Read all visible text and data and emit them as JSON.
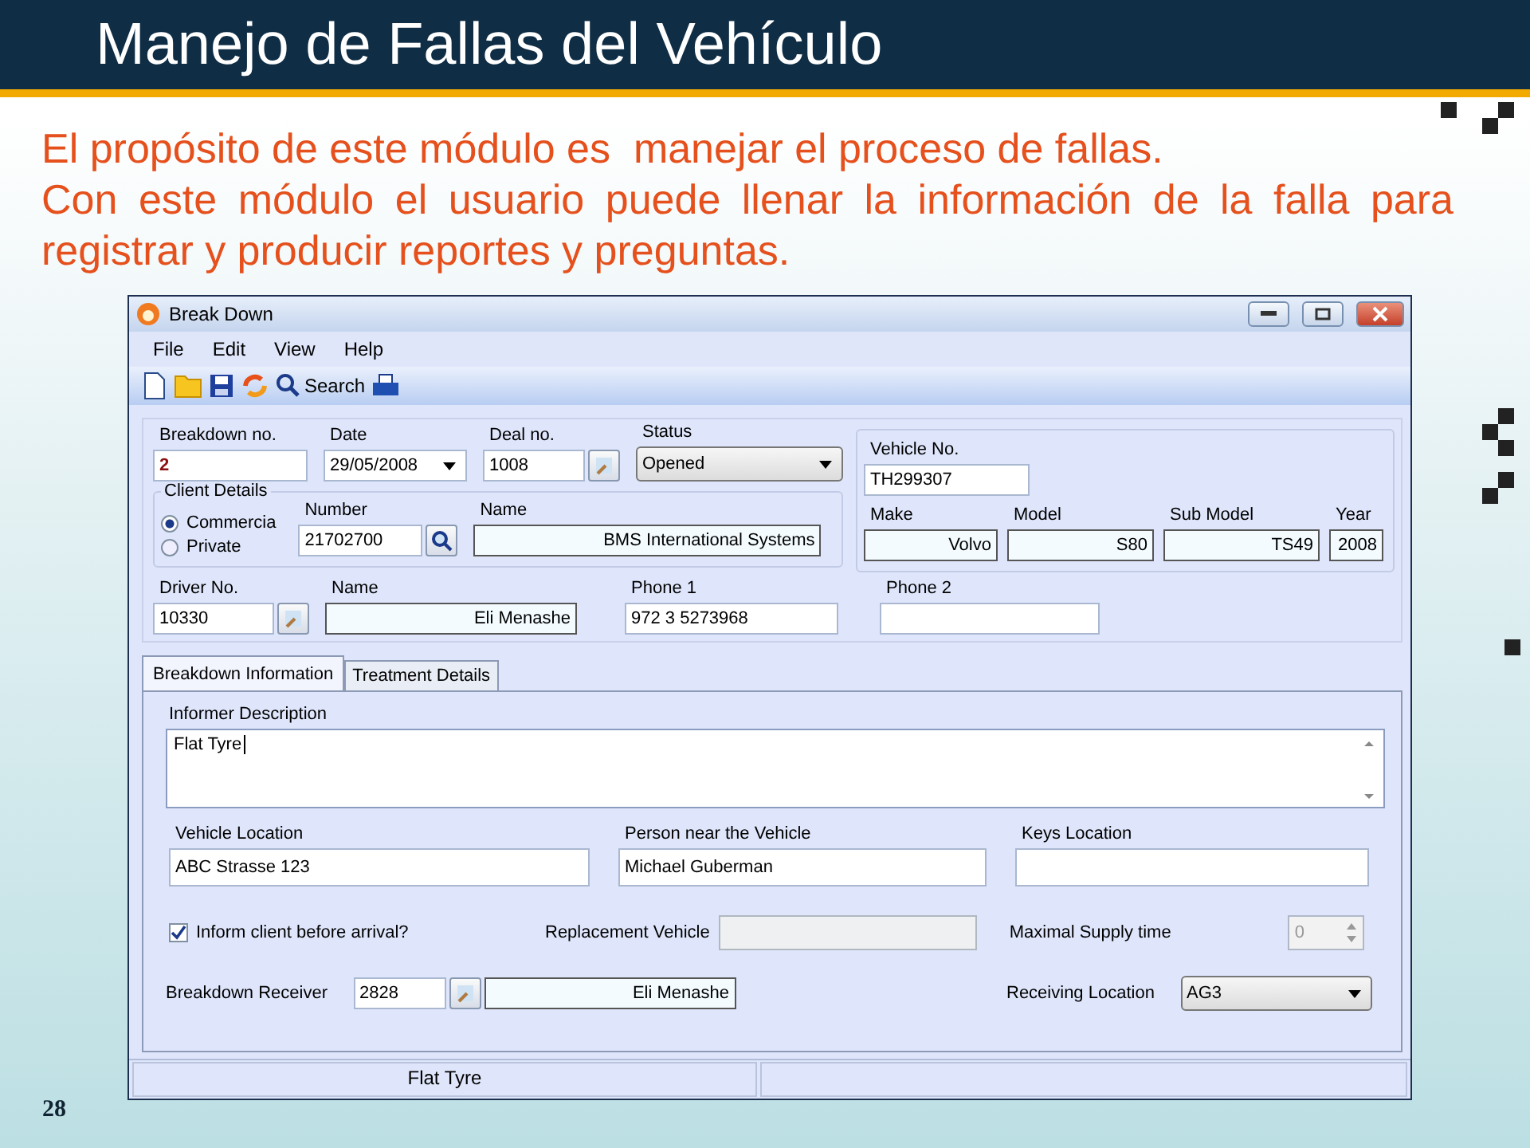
{
  "slide": {
    "title": "Manejo de Fallas del Vehículo",
    "intro": [
      "El propósito de este módulo es  manejar el proceso de fallas.",
      "Con este módulo el usuario puede llenar la información de la falla para registrar y producir reportes y preguntas."
    ],
    "page_number": "28"
  },
  "window": {
    "title": "Break Down",
    "menu": [
      "File",
      "Edit",
      "View",
      "Help"
    ],
    "toolbar_search": "Search"
  },
  "header": {
    "breakdown_no": {
      "label": "Breakdown no.",
      "value": "2"
    },
    "date": {
      "label": "Date",
      "value": "29/05/2008"
    },
    "deal_no": {
      "label": "Deal no.",
      "value": "1008"
    },
    "status": {
      "label": "Status",
      "value": "Opened"
    },
    "client_details": {
      "title": "Client Details",
      "options": [
        {
          "label": "Commercia",
          "selected": true
        },
        {
          "label": "Private",
          "selected": false
        }
      ],
      "number": {
        "label": "Number",
        "value": "21702700"
      },
      "name": {
        "label": "Name",
        "value": "BMS International Systems"
      }
    },
    "vehicle_no": {
      "label": "Vehicle No.",
      "value": "TH299307"
    },
    "vehicle": [
      {
        "label": "Make",
        "value": "Volvo"
      },
      {
        "label": "Model",
        "value": "S80"
      },
      {
        "label": "Sub Model",
        "value": "TS49"
      },
      {
        "label": "Year",
        "value": "2008"
      }
    ],
    "driver_no": {
      "label": "Driver No.",
      "value": "10330"
    },
    "driver_name": {
      "label": "Name",
      "value": "Eli Menashe"
    },
    "phone1": {
      "label": "Phone 1",
      "value": "972 3 5273968"
    },
    "phone2": {
      "label": "Phone 2"
    }
  },
  "tabs": [
    {
      "label": "Breakdown Information",
      "selected": true
    },
    {
      "label": "Treatment Details",
      "selected": false
    }
  ],
  "breakdown_info": {
    "informer_description": {
      "label": "Informer Description",
      "value": "Flat Tyre"
    },
    "locations": [
      {
        "label": "Vehicle Location",
        "value": "ABC Strasse 123"
      },
      {
        "label": "Person near the Vehicle",
        "value": "Michael Guberman"
      },
      {
        "label": "Keys Location"
      }
    ],
    "inform_client": {
      "label": "Inform client before arrival?",
      "checked": true
    },
    "replacement_vehicle": {
      "label": "Replacement Vehicle",
      "disabled": true
    },
    "maximal_supply_time": {
      "label": "Maximal Supply time",
      "value": "0",
      "disabled": true
    },
    "breakdown_receiver": {
      "label": "Breakdown Receiver",
      "number": "2828",
      "name": "Eli Menashe"
    },
    "receiving_location": {
      "label": "Receiving Location",
      "value": "AG3"
    }
  },
  "status_bar": [
    "Flat Tyre"
  ]
}
